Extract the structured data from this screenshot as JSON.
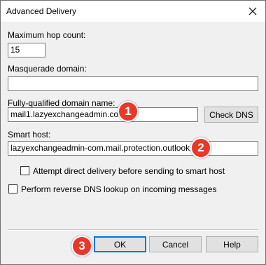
{
  "window": {
    "title": "Advanced Delivery"
  },
  "fields": {
    "max_hop_label": "Maximum hop count:",
    "max_hop_value": "15",
    "masquerade_label": "Masquerade domain:",
    "masquerade_value": "",
    "fqdn_label": "Fully-qualified domain name:",
    "fqdn_value": "mail1.lazyexchangeadmin.com",
    "smart_host_label": "Smart host:",
    "smart_host_value": "lazyexchangeadmin-com.mail.protection.outlook.com"
  },
  "checkboxes": {
    "direct_delivery_label": "Attempt direct delivery before sending to smart host",
    "direct_delivery_checked": false,
    "reverse_dns_label": "Perform reverse DNS lookup on incoming messages",
    "reverse_dns_checked": false
  },
  "buttons": {
    "check_dns": "Check DNS",
    "ok": "OK",
    "cancel": "Cancel",
    "help": "Help"
  },
  "annotations": {
    "step1": "1",
    "step2": "2",
    "step3": "3",
    "badge_color": "#e8382c"
  },
  "icons": {
    "close": "close-icon"
  }
}
